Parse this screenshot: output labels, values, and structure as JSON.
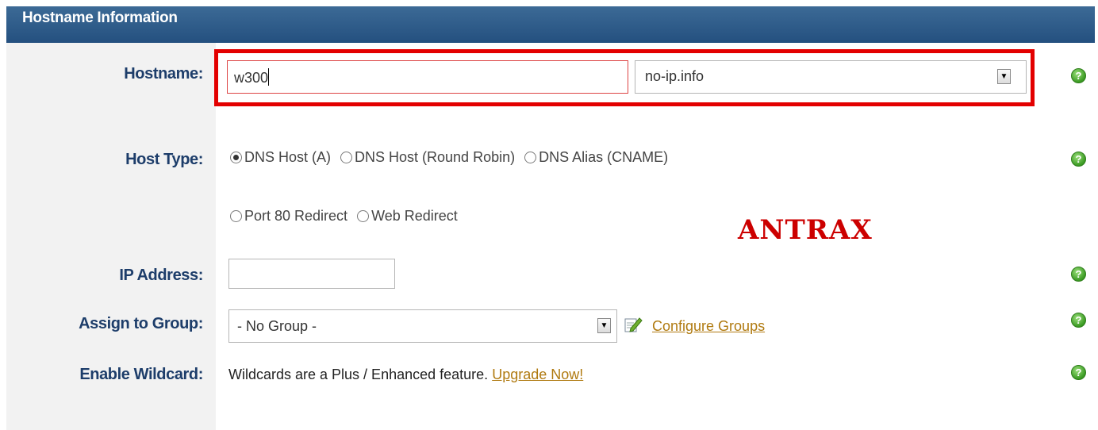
{
  "section": {
    "title": "Hostname Information"
  },
  "labels": {
    "hostname": "Hostname:",
    "host_type": "Host Type:",
    "ip_address": "IP Address:",
    "assign_group": "Assign to Group:",
    "enable_wildcard": "Enable Wildcard:"
  },
  "hostname": {
    "value": "w300",
    "domain": "no-ip.info"
  },
  "host_type": {
    "options": [
      {
        "label": "DNS Host (A)",
        "selected": true
      },
      {
        "label": "DNS Host (Round Robin)",
        "selected": false
      },
      {
        "label": "DNS Alias (CNAME)",
        "selected": false
      },
      {
        "label": "Port 80 Redirect",
        "selected": false
      },
      {
        "label": "Web Redirect",
        "selected": false
      }
    ]
  },
  "watermark": "ANTRAX",
  "ip_address": {
    "value": ""
  },
  "group": {
    "selected": "- No Group -",
    "configure_link": "Configure Groups"
  },
  "wildcard": {
    "text": "Wildcards are a Plus / Enhanced feature.",
    "upgrade_link": "Upgrade Now!"
  },
  "icons": {
    "help": "help-icon",
    "select_arrow": "chevron-down-icon",
    "edit": "edit-icon"
  },
  "colors": {
    "header_bg": "#2d5b8a",
    "label_text": "#1d3d6a",
    "link": "#b07a10",
    "highlight": "#e30000",
    "watermark": "#cc0000"
  }
}
